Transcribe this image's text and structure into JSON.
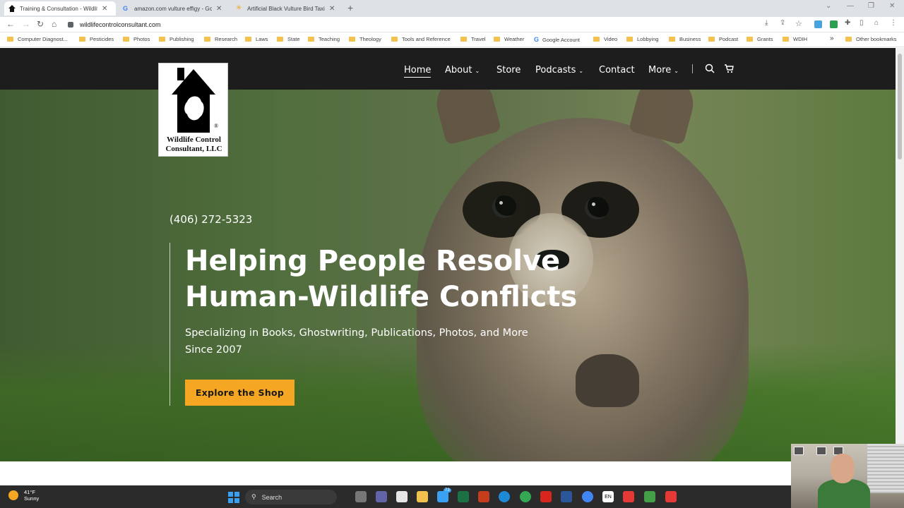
{
  "browser": {
    "tabs": [
      {
        "title": "Training & Consultation - Wildlif",
        "active": true
      },
      {
        "title": "amazon.com vulture effigy - Goo",
        "active": false
      },
      {
        "title": "Artificial Black Vulture Bird Taxid",
        "active": false
      }
    ],
    "new_tab_label": "+",
    "url": "wildlifecontrolconsultant.com",
    "bookmarks": [
      "Computer Diagnost...",
      "Pesticides",
      "Photos",
      "Publishing",
      "Research",
      "Laws",
      "State",
      "Teaching",
      "Theology",
      "Tools and Reference",
      "Travel",
      "Weather",
      "Google Account",
      "Video",
      "Lobbying",
      "Business",
      "Podcast",
      "Grants",
      "WDIH"
    ],
    "bookmarks_overflow": "»",
    "other_bookmarks": "Other bookmarks"
  },
  "site": {
    "logo_text": "Wildlife Control Consultant, LLC",
    "logo_line1": "Wildlife Control",
    "logo_line2": "Consultant, LLC",
    "registered_mark": "®",
    "nav": {
      "home": "Home",
      "about": "About",
      "store": "Store",
      "podcasts": "Podcasts",
      "contact": "Contact",
      "more": "More"
    },
    "icons": {
      "search": "search-icon",
      "cart": "cart-icon"
    },
    "hero": {
      "phone": "(406) 272-5323",
      "headline_line1": "Helping People Resolve",
      "headline_line2": "Human-Wildlife Conflicts",
      "subline1": "Specializing in Books, Ghostwriting, Publications, Photos, and More",
      "subline2": "Since 2007",
      "cta": "Explore the Shop"
    },
    "colors": {
      "header_bg": "#1d1d1d",
      "cta_bg": "#f5a623"
    }
  },
  "taskbar": {
    "weather_temp": "41°F",
    "weather_desc": "Sunny",
    "search_label": "Search",
    "badge": "73",
    "lang": "EN"
  }
}
